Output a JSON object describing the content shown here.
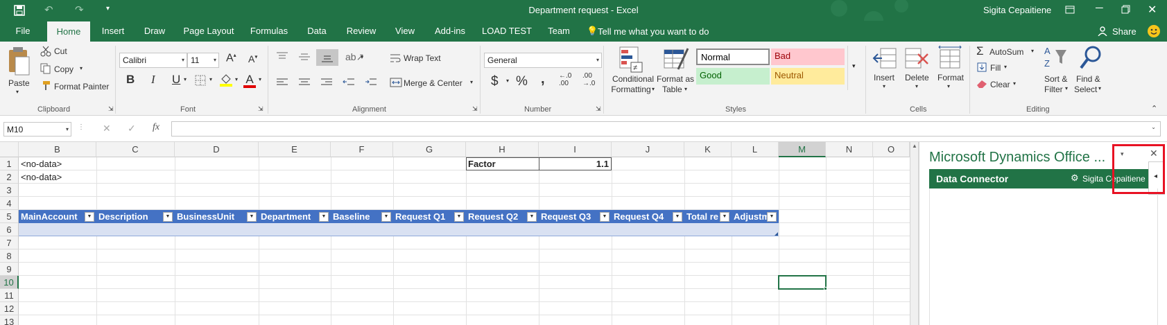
{
  "window": {
    "title": "Department request  -  Excel",
    "user": "Sigita Cepaitiene"
  },
  "tabs": [
    "File",
    "Home",
    "Insert",
    "Draw",
    "Page Layout",
    "Formulas",
    "Data",
    "Review",
    "View",
    "Add-ins",
    "LOAD TEST",
    "Team"
  ],
  "tell_me": "Tell me what you want to do",
  "share_label": "Share",
  "ribbon": {
    "clipboard": {
      "paste": "Paste",
      "cut": "Cut",
      "copy": "Copy",
      "format_painter": "Format Painter",
      "label": "Clipboard"
    },
    "font": {
      "name": "Calibri",
      "size": "11",
      "label": "Font"
    },
    "alignment": {
      "wrap_text": "Wrap Text",
      "merge_center": "Merge & Center",
      "label": "Alignment"
    },
    "number": {
      "format": "General",
      "label": "Number"
    },
    "styles": {
      "conditional_1": "Conditional",
      "conditional_2": "Formatting",
      "format_as_1": "Format as",
      "format_as_2": "Table",
      "normal": "Normal",
      "bad": "Bad",
      "good": "Good",
      "neutral": "Neutral",
      "label": "Styles"
    },
    "cells": {
      "insert": "Insert",
      "delete": "Delete",
      "format": "Format",
      "label": "Cells"
    },
    "editing": {
      "autosum": "AutoSum",
      "fill": "Fill",
      "clear": "Clear",
      "sort_1": "Sort &",
      "sort_2": "Filter",
      "find_1": "Find &",
      "find_2": "Select",
      "label": "Editing"
    }
  },
  "formula_bar": {
    "name_box": "M10",
    "value": ""
  },
  "columns": [
    "B",
    "C",
    "D",
    "E",
    "F",
    "G",
    "H",
    "I",
    "J",
    "K",
    "L",
    "M",
    "N",
    "O"
  ],
  "rows": [
    "1",
    "2",
    "3",
    "4",
    "5",
    "6",
    "7",
    "8",
    "9",
    "10",
    "11",
    "12",
    "13"
  ],
  "cells": {
    "b1": "<no-data>",
    "b2": "<no-data>",
    "h1": "Factor",
    "i1": "1.1"
  },
  "table_headers": [
    "MainAccount",
    "Description",
    "BusinessUnit",
    "Department",
    "Baseline",
    "Request Q1",
    "Request Q2",
    "Request Q3",
    "Request Q4",
    "Total re",
    "Adjustm"
  ],
  "pane": {
    "title": "Microsoft Dynamics Office ...",
    "connector": "Data Connector",
    "user": "Sigita Cepaitiene"
  },
  "colors": {
    "excel_green": "#217346",
    "table_header": "#4472c4",
    "table_band": "#d9e1f2",
    "highlight": "#e81123"
  }
}
